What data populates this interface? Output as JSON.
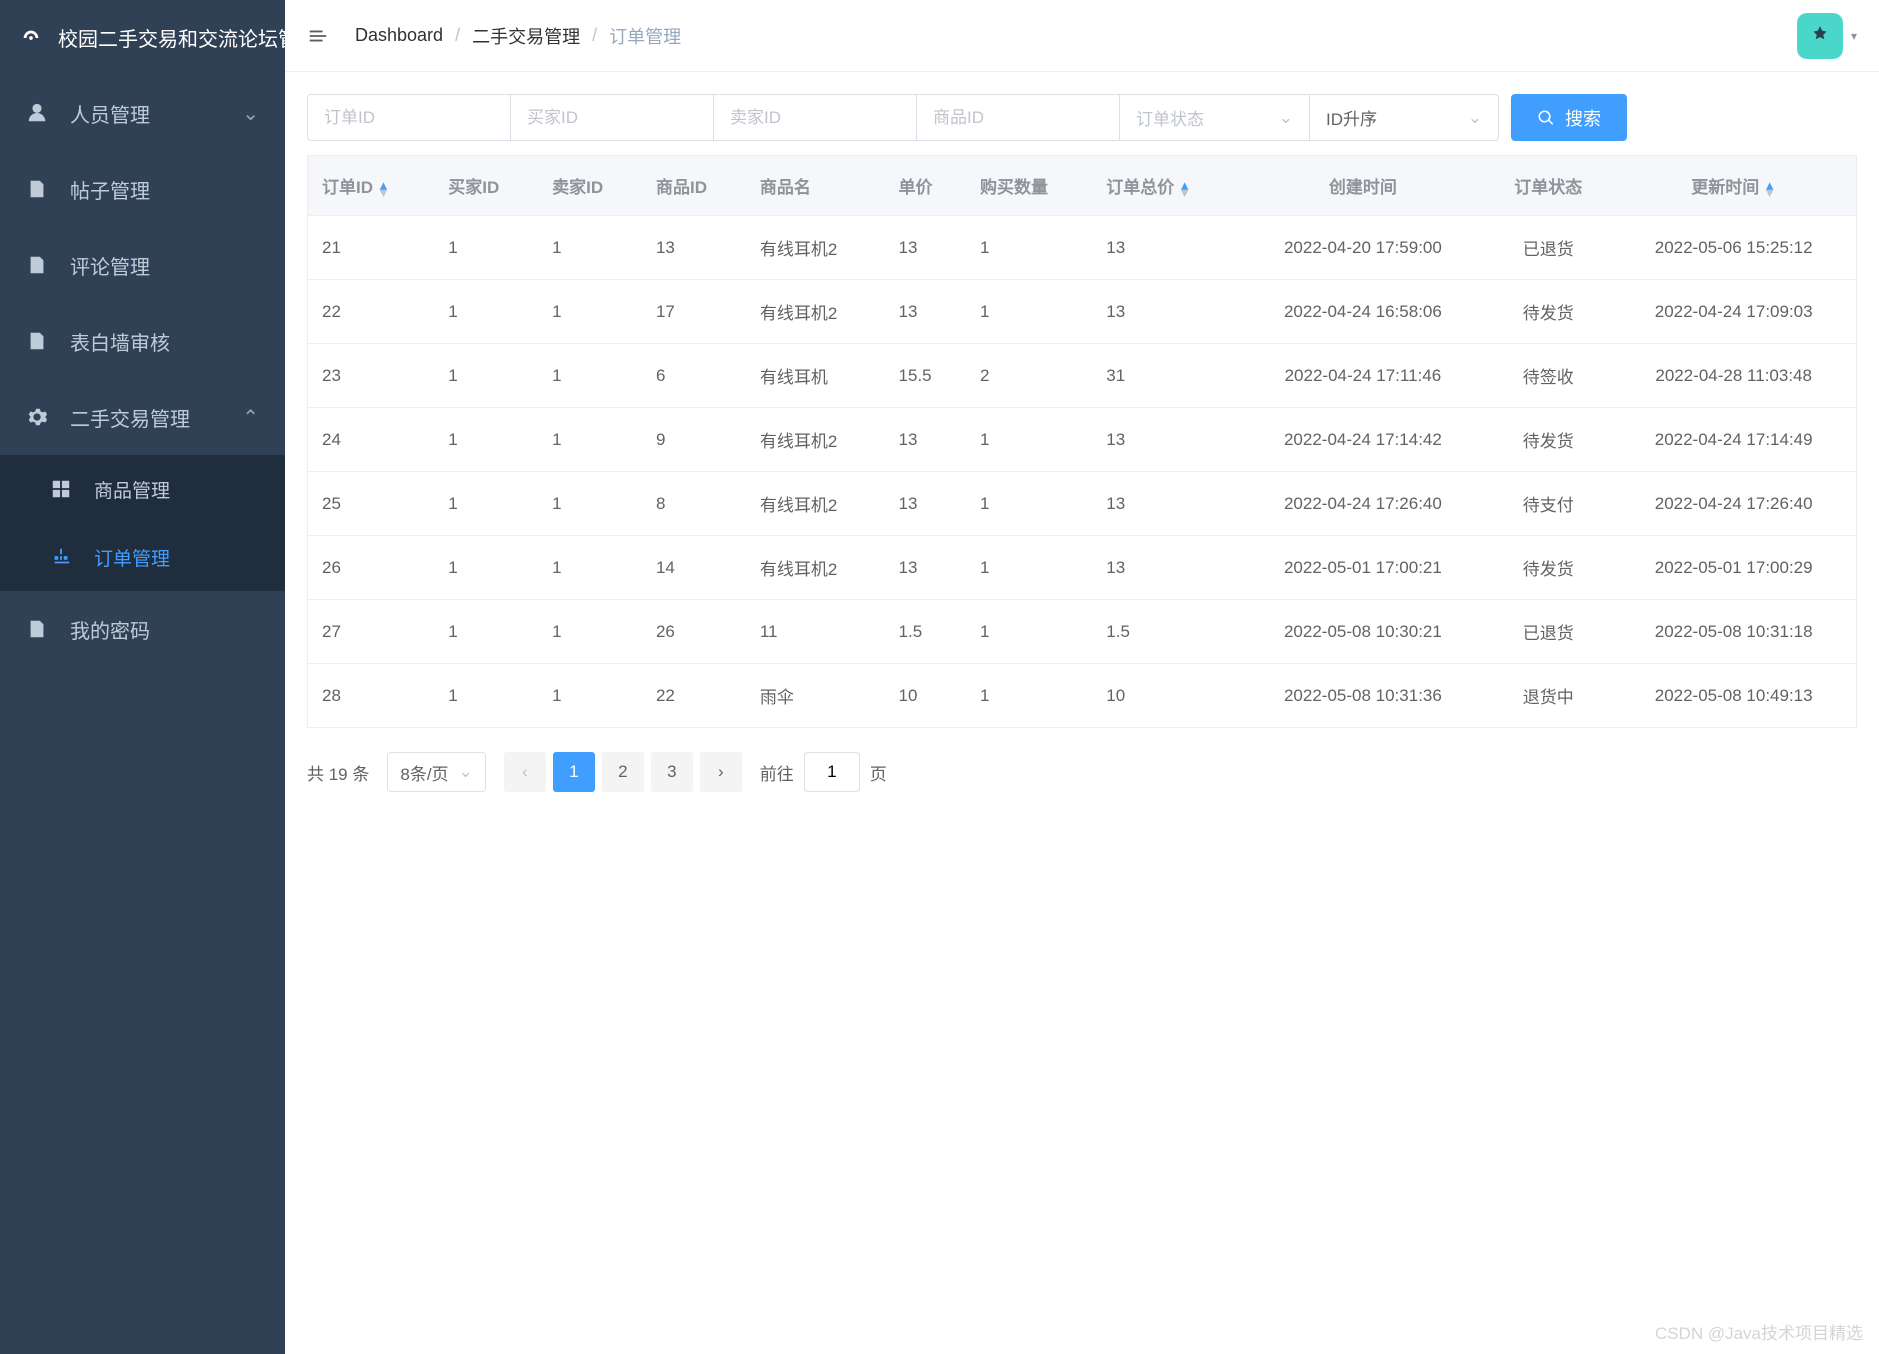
{
  "app_title": "校园二手交易和交流论坛管",
  "sidebar": {
    "items": [
      {
        "icon": "users",
        "label": "人员管理",
        "has_sub": true,
        "expanded": false
      },
      {
        "icon": "doc",
        "label": "帖子管理"
      },
      {
        "icon": "doc",
        "label": "评论管理"
      },
      {
        "icon": "doc",
        "label": "表白墙审核"
      },
      {
        "icon": "gear",
        "label": "二手交易管理",
        "has_sub": true,
        "expanded": true,
        "children": [
          {
            "icon": "grid",
            "label": "商品管理"
          },
          {
            "icon": "tree",
            "label": "订单管理",
            "active": true
          }
        ]
      },
      {
        "icon": "doc",
        "label": "我的密码"
      }
    ]
  },
  "breadcrumb": {
    "items": [
      "Dashboard",
      "二手交易管理",
      "订单管理"
    ]
  },
  "filters": {
    "order_id_ph": "订单ID",
    "buyer_id_ph": "买家ID",
    "seller_id_ph": "卖家ID",
    "product_id_ph": "商品ID",
    "status_ph": "订单状态",
    "sort_value": "ID升序",
    "search_label": "搜索"
  },
  "table": {
    "headers": [
      "订单ID",
      "买家ID",
      "卖家ID",
      "商品ID",
      "商品名",
      "单价",
      "购买数量",
      "订单总价",
      "创建时间",
      "订单状态",
      "更新时间"
    ],
    "rows": [
      {
        "订单ID": "21",
        "买家ID": "1",
        "卖家ID": "1",
        "商品ID": "13",
        "商品名": "有线耳机2",
        "单价": "13",
        "购买数量": "1",
        "订单总价": "13",
        "创建时间": "2022-04-20 17:59:00",
        "订单状态": "已退货",
        "更新时间": "2022-05-06 15:25:12"
      },
      {
        "订单ID": "22",
        "买家ID": "1",
        "卖家ID": "1",
        "商品ID": "17",
        "商品名": "有线耳机2",
        "单价": "13",
        "购买数量": "1",
        "订单总价": "13",
        "创建时间": "2022-04-24 16:58:06",
        "订单状态": "待发货",
        "更新时间": "2022-04-24 17:09:03"
      },
      {
        "订单ID": "23",
        "买家ID": "1",
        "卖家ID": "1",
        "商品ID": "6",
        "商品名": "有线耳机",
        "单价": "15.5",
        "购买数量": "2",
        "订单总价": "31",
        "创建时间": "2022-04-24 17:11:46",
        "订单状态": "待签收",
        "更新时间": "2022-04-28 11:03:48"
      },
      {
        "订单ID": "24",
        "买家ID": "1",
        "卖家ID": "1",
        "商品ID": "9",
        "商品名": "有线耳机2",
        "单价": "13",
        "购买数量": "1",
        "订单总价": "13",
        "创建时间": "2022-04-24 17:14:42",
        "订单状态": "待发货",
        "更新时间": "2022-04-24 17:14:49"
      },
      {
        "订单ID": "25",
        "买家ID": "1",
        "卖家ID": "1",
        "商品ID": "8",
        "商品名": "有线耳机2",
        "单价": "13",
        "购买数量": "1",
        "订单总价": "13",
        "创建时间": "2022-04-24 17:26:40",
        "订单状态": "待支付",
        "更新时间": "2022-04-24 17:26:40"
      },
      {
        "订单ID": "26",
        "买家ID": "1",
        "卖家ID": "1",
        "商品ID": "14",
        "商品名": "有线耳机2",
        "单价": "13",
        "购买数量": "1",
        "订单总价": "13",
        "创建时间": "2022-05-01 17:00:21",
        "订单状态": "待发货",
        "更新时间": "2022-05-01 17:00:29"
      },
      {
        "订单ID": "27",
        "买家ID": "1",
        "卖家ID": "1",
        "商品ID": "26",
        "商品名": "11",
        "单价": "1.5",
        "购买数量": "1",
        "订单总价": "1.5",
        "创建时间": "2022-05-08 10:30:21",
        "订单状态": "已退货",
        "更新时间": "2022-05-08 10:31:18"
      },
      {
        "订单ID": "28",
        "买家ID": "1",
        "卖家ID": "1",
        "商品ID": "22",
        "商品名": "雨伞",
        "单价": "10",
        "购买数量": "1",
        "订单总价": "10",
        "创建时间": "2022-05-08 10:31:36",
        "订单状态": "退货中",
        "更新时间": "2022-05-08 10:49:13"
      }
    ]
  },
  "pagination": {
    "total_label": "共 19 条",
    "page_size_label": "8条/页",
    "pages": [
      "1",
      "2",
      "3"
    ],
    "current": 1,
    "jump_prefix": "前往",
    "jump_value": "1",
    "jump_suffix": "页"
  },
  "watermark": "CSDN @Java技术项目精选"
}
